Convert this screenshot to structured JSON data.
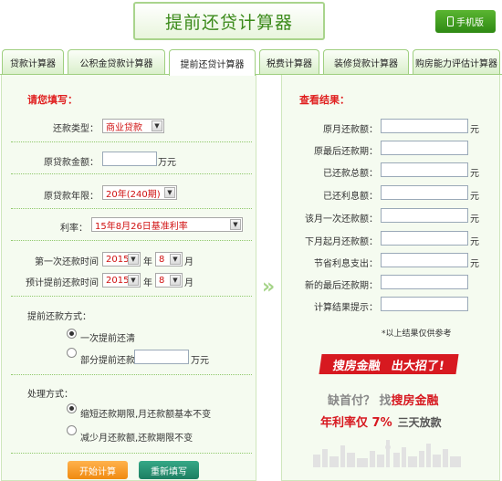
{
  "header": {
    "title": "提前还贷计算器",
    "mobile_label": "手机版"
  },
  "tabs": [
    {
      "label": "贷款计算器",
      "active": false
    },
    {
      "label": "公积金贷款计算器",
      "active": false
    },
    {
      "label": "提前还贷计算器",
      "active": true
    },
    {
      "label": "税费计算器",
      "active": false
    },
    {
      "label": "装修贷款计算器",
      "active": false
    },
    {
      "label": "购房能力评估计算器",
      "active": false
    }
  ],
  "form": {
    "section_title": "请您填写：",
    "loan_type_label": "还款类型：",
    "loan_type_value": "商业贷款",
    "amount_label": "原贷款金额：",
    "amount_value": "",
    "amount_unit": "万元",
    "term_label": "原贷款年限：",
    "term_value": "20年(240期)",
    "rate_label": "利率：",
    "rate_value": "15年8月26日基准利率",
    "first_pay_label": "第一次还款时间",
    "first_pay_year": "2015",
    "first_pay_month": "8",
    "prepay_label": "预计提前还款时间",
    "prepay_year": "2015",
    "prepay_month": "8",
    "year_unit": "年",
    "month_unit": "月",
    "prepay_method_label": "提前还款方式：",
    "prepay_all": "一次提前还清",
    "prepay_part": "部分提前还款",
    "prepay_part_value": "",
    "prepay_part_unit": "万元",
    "handle_label": "处理方式：",
    "handle_opt1": "缩短还款期限,月还款额基本不变",
    "handle_opt2": "减少月还款额,还款期限不变",
    "start_button": "开始计算",
    "reset_button": "重新填写"
  },
  "results": {
    "section_title": "查看结果：",
    "rows": [
      {
        "label": "原月还款额：",
        "unit": "元",
        "value": ""
      },
      {
        "label": "原最后还款期：",
        "unit": "",
        "value": ""
      },
      {
        "label": "已还款总额：",
        "unit": "元",
        "value": ""
      },
      {
        "label": "已还利息额：",
        "unit": "元",
        "value": ""
      },
      {
        "label": "该月一次还款额：",
        "unit": "元",
        "value": ""
      },
      {
        "label": "下月起月还款额：",
        "unit": "元",
        "value": ""
      },
      {
        "label": "节省利息支出：",
        "unit": "元",
        "value": ""
      },
      {
        "label": "新的最后还款期：",
        "unit": "",
        "value": ""
      },
      {
        "label": "计算结果提示：",
        "unit": "",
        "value": ""
      }
    ],
    "note": "*以上结果仅供参考"
  },
  "ad": {
    "banner_left": "搜房金融",
    "banner_right": "出大招了!",
    "line1_gray": "缺首付？ 找",
    "line1_red": "搜房金融",
    "line2_red": "年利率仅 7%",
    "line2_gray": "三天放款"
  },
  "colors": {
    "accent_green": "#3b8a1a",
    "red": "#d71920",
    "orange": "#f08a10",
    "teal": "#1d7e61"
  }
}
